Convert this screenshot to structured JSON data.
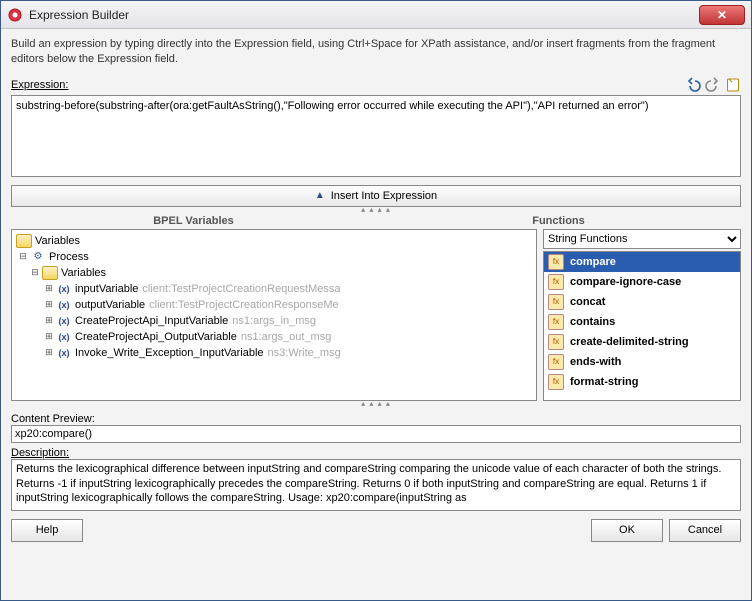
{
  "window": {
    "title": "Expression Builder"
  },
  "instruction": "Build an expression by typing directly into the Expression field, using Ctrl+Space for XPath assistance, and/or insert fragments from the fragment editors below the Expression field.",
  "expression": {
    "label": "Expression:",
    "value": "substring-before(substring-after(ora:getFaultAsString(),\"Following error occurred while executing the API\"),\"API returned an error\")"
  },
  "insert_button": "Insert Into Expression",
  "panes": {
    "left_title": "BPEL Variables",
    "right_title": "Functions"
  },
  "tree": {
    "root": "Variables",
    "process": "Process",
    "vars_folder": "Variables",
    "items": [
      {
        "name": "inputVariable",
        "type": "client:TestProjectCreationRequestMessa"
      },
      {
        "name": "outputVariable",
        "type": "client:TestProjectCreationResponseMe"
      },
      {
        "name": "CreateProjectApi_InputVariable",
        "type": "ns1:args_in_msg"
      },
      {
        "name": "CreateProjectApi_OutputVariable",
        "type": "ns1:args_out_msg"
      },
      {
        "name": "Invoke_Write_Exception_InputVariable",
        "type": "ns3:Write_msg"
      }
    ]
  },
  "functions": {
    "category": "String Functions",
    "items": [
      "compare",
      "compare-ignore-case",
      "concat",
      "contains",
      "create-delimited-string",
      "ends-with",
      "format-string"
    ],
    "selected": "compare"
  },
  "preview": {
    "label": "Content Preview:",
    "value": "xp20:compare()"
  },
  "description": {
    "label": "Description:",
    "value": "Returns the lexicographical difference between inputString and compareString comparing the unicode value of each character of both the strings. Returns -1 if inputString lexicographically precedes the compareString. Returns 0 if both inputString and compareString are equal. Returns 1 if inputString lexicographically follows the compareString. Usage: xp20:compare(inputString as"
  },
  "buttons": {
    "help": "Help",
    "ok": "OK",
    "cancel": "Cancel"
  }
}
